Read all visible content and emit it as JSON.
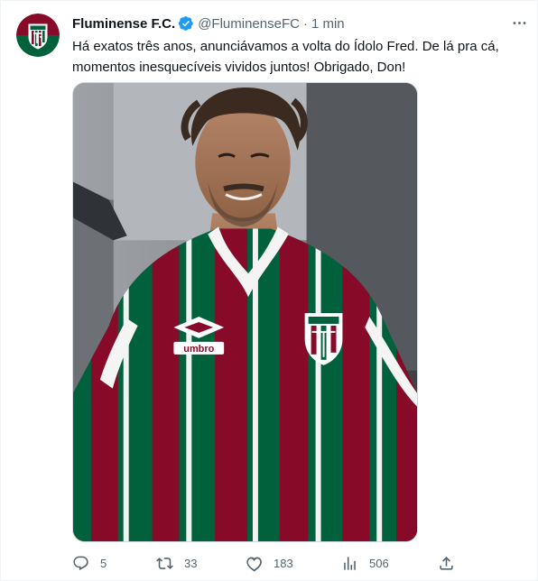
{
  "author": {
    "display_name": "Fluminense F.C.",
    "handle": "@FluminenseFC",
    "separator": "·",
    "timestamp": "1 min",
    "verified": true,
    "avatar_icon": "fluminense-crest-icon"
  },
  "tweet": {
    "text_lines": [
      "Há exatos três anos, anunciávamos a volta do Ídolo Fred. De lá pra cá,",
      "momentos inesquecíveis vividos juntos! Obrigado, Don!"
    ]
  },
  "media": {
    "kind": "photo",
    "shirt_brand_text": "umbro"
  },
  "actions": {
    "reply": {
      "icon": "reply-icon",
      "count": "5"
    },
    "retweet": {
      "icon": "retweet-icon",
      "count": "33"
    },
    "like": {
      "icon": "heart-icon",
      "count": "183"
    },
    "views": {
      "icon": "views-icon",
      "count": "506"
    },
    "share": {
      "icon": "share-icon"
    }
  },
  "colors": {
    "text": "#0f1419",
    "secondary": "#536471",
    "verified": "#1d9bf0",
    "club_green": "#00613c",
    "club_maroon": "#870a28",
    "border": "#eff3f4"
  }
}
